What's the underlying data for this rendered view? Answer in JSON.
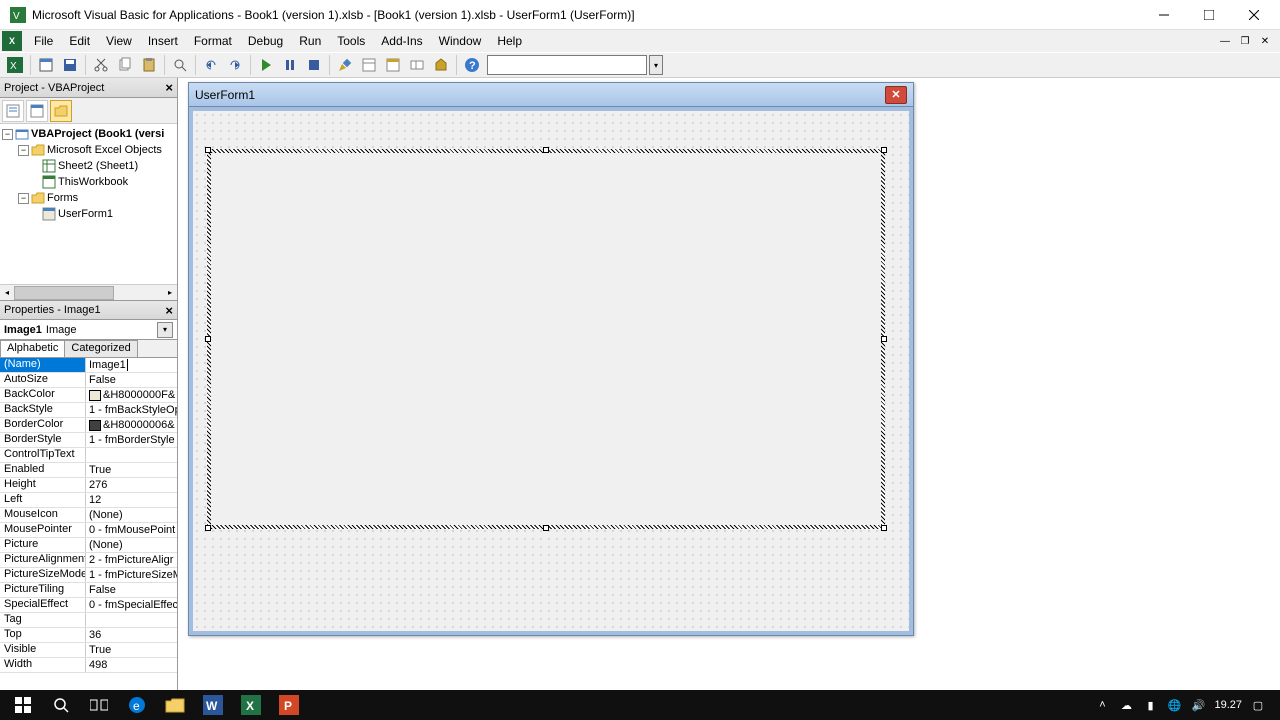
{
  "title": "Microsoft Visual Basic for Applications - Book1 (version 1).xlsb - [Book1 (version 1).xlsb - UserForm1 (UserForm)]",
  "menu": [
    "File",
    "Edit",
    "View",
    "Insert",
    "Format",
    "Debug",
    "Run",
    "Tools",
    "Add-Ins",
    "Window",
    "Help"
  ],
  "project": {
    "header": "Project - VBAProject",
    "root": "VBAProject (Book1 (versi",
    "excel_objects": "Microsoft Excel Objects",
    "sheet": "Sheet2 (Sheet1)",
    "workbook": "ThisWorkbook",
    "forms": "Forms",
    "userform": "UserForm1"
  },
  "properties": {
    "header": "Properties - Image1",
    "objname": "Image1",
    "objtype": "Image",
    "tabs": {
      "alpha": "Alphabetic",
      "cat": "Categorized"
    },
    "rows": [
      {
        "name": "(Name)",
        "value": "Image1",
        "selected": true,
        "cursor": true
      },
      {
        "name": "AutoSize",
        "value": "False"
      },
      {
        "name": "BackColor",
        "value": "&H8000000F&",
        "swatch": "#ece9d8"
      },
      {
        "name": "BackStyle",
        "value": "1 - fmBackStyleOp"
      },
      {
        "name": "BorderColor",
        "value": "&H80000006&",
        "swatch": "#404040"
      },
      {
        "name": "BorderStyle",
        "value": "1 - fmBorderStyle"
      },
      {
        "name": "ControlTipText",
        "value": ""
      },
      {
        "name": "Enabled",
        "value": "True"
      },
      {
        "name": "Height",
        "value": "276"
      },
      {
        "name": "Left",
        "value": "12"
      },
      {
        "name": "MouseIcon",
        "value": "(None)"
      },
      {
        "name": "MousePointer",
        "value": "0 - fmMousePoint"
      },
      {
        "name": "Picture",
        "value": "(None)"
      },
      {
        "name": "PictureAlignment",
        "value": "2 - fmPictureAligr"
      },
      {
        "name": "PictureSizeMode",
        "value": "1 - fmPictureSizeM"
      },
      {
        "name": "PictureTiling",
        "value": "False"
      },
      {
        "name": "SpecialEffect",
        "value": "0 - fmSpecialEffec"
      },
      {
        "name": "Tag",
        "value": ""
      },
      {
        "name": "Top",
        "value": "36"
      },
      {
        "name": "Visible",
        "value": "True"
      },
      {
        "name": "Width",
        "value": "498"
      }
    ]
  },
  "form": {
    "title": "UserForm1"
  },
  "tray": {
    "time": "19.27"
  }
}
